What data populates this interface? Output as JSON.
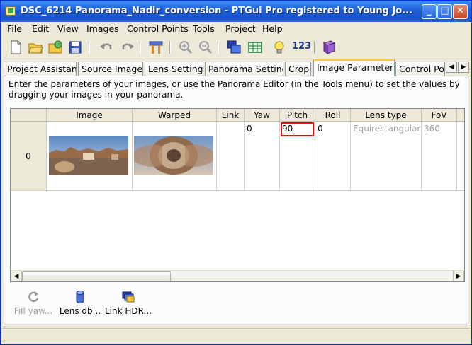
{
  "window": {
    "title": "DSC_6214 Panorama_Nadir_conversion - PTGui Pro registered to Young Jo...",
    "controls": {
      "minimize": "_",
      "maximize": "□",
      "close": "✕"
    }
  },
  "menu": [
    "File",
    "Edit",
    "View",
    "Images",
    "Control Points",
    "Tools",
    "Project",
    "Help"
  ],
  "toolbar": {
    "icons": [
      "new-project-icon",
      "open-project-icon",
      "open-recent-icon",
      "save-icon",
      "undo-icon",
      "redo-icon",
      "align-images-icon",
      "zoom-in-icon",
      "zoom-out-icon",
      "panorama-editor-icon",
      "table-icon",
      "lightbulb-icon",
      "numbers-icon",
      "help-book-icon"
    ],
    "numbers_label": "123"
  },
  "tabs": [
    "Project Assistant",
    "Source Images",
    "Lens Settings",
    "Panorama Settings",
    "Crop",
    "Image Parameters",
    "Control Poin"
  ],
  "active_tab": "Image Parameters",
  "instructions": "Enter the parameters of your images, or use the Panorama Editor (in the Tools menu) to set the values by dragging your images in your panorama.",
  "grid": {
    "columns": [
      "Image",
      "Warped",
      "Link",
      "Yaw",
      "Pitch",
      "Roll",
      "Lens type",
      "FoV"
    ],
    "rows": [
      {
        "index": "0",
        "link": "",
        "yaw": "0",
        "pitch": "90",
        "roll": "0",
        "lens_type": "Equirectangular",
        "fov": "360"
      }
    ]
  },
  "actions": [
    {
      "label": "Fill yaw...",
      "icon": "refresh-icon",
      "enabled": false
    },
    {
      "label": "Lens db...",
      "icon": "database-icon",
      "enabled": true
    },
    {
      "label": "Link HDR...",
      "icon": "stack-icon",
      "enabled": true
    }
  ],
  "colors": {
    "titlebar": "#1f5fd9",
    "highlight": "#e01010",
    "active_tab_accent": "#ffc83c"
  }
}
